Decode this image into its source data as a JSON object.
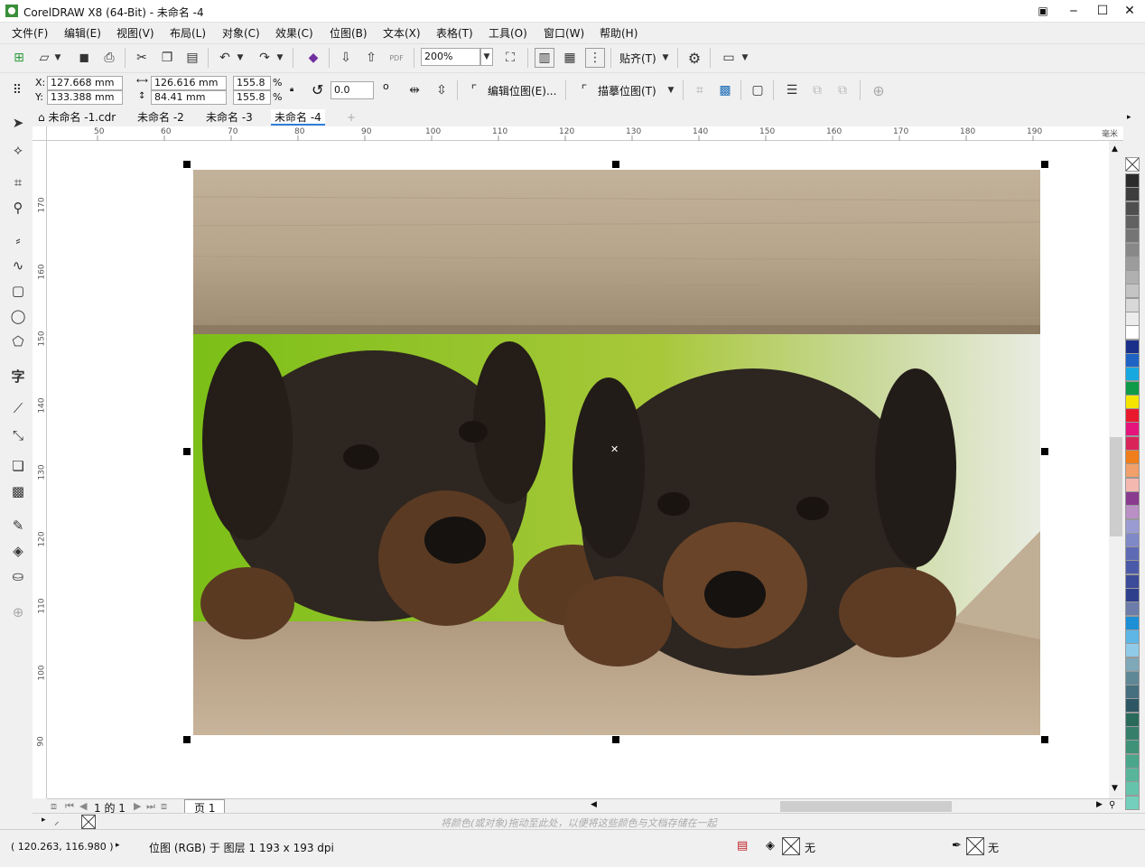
{
  "window": {
    "title": "CorelDRAW X8 (64-Bit) - 未命名 -4",
    "min": "‒",
    "max": "☐",
    "close": "✕"
  },
  "menu": [
    "文件(F)",
    "编辑(E)",
    "视图(V)",
    "布局(L)",
    "对象(C)",
    "效果(C)",
    "位图(B)",
    "文本(X)",
    "表格(T)",
    "工具(O)",
    "窗口(W)",
    "帮助(H)"
  ],
  "standard_toolbar": {
    "zoom_value": "200%",
    "snap_label": "贴齐(T)",
    "pdf_label": "PDF"
  },
  "property_bar": {
    "x_label": "X:",
    "y_label": "Y:",
    "x_value": "127.668 mm",
    "y_value": "133.388 mm",
    "w_value": "126.616 mm",
    "h_value": "84.41 mm",
    "scale_x": "155.8",
    "scale_y": "155.8",
    "pct": "%",
    "rotation": "0.0",
    "degree": "o",
    "edit_bitmap": "编辑位图(E)...",
    "trace_bitmap": "描摹位图(T)"
  },
  "doc_tabs": [
    "未命名 -1.cdr",
    "未命名 -2",
    "未命名 -3",
    "未命名 -4"
  ],
  "active_tab": 3,
  "ruler_h": [
    "50",
    "60",
    "70",
    "80",
    "90",
    "100",
    "110",
    "120",
    "130",
    "140",
    "150",
    "160",
    "170",
    "180",
    "190"
  ],
  "ruler_unit": "毫米",
  "ruler_v": [
    "170",
    "160",
    "150",
    "140",
    "130",
    "120",
    "110",
    "100",
    "90"
  ],
  "pagebar": {
    "page_of": "1 的 1",
    "page_tab": "页 1"
  },
  "hint": "将颜色(或对象)拖动至此处，以便将这些颜色与文档存储在一起",
  "status": {
    "coords": "( 120.263, 116.980 )",
    "object_info": "位图 (RGB) 于 图层 1 193 x 193 dpi",
    "fill": "无",
    "outline": "无"
  },
  "palette_colors": [
    "#2b2b2b",
    "#3d3d3d",
    "#4f4f4f",
    "#626262",
    "#757575",
    "#888888",
    "#9c9c9c",
    "#b0b0b0",
    "#c4c4c4",
    "#d8d8d8",
    "#ececec",
    "#ffffff",
    "#1a2f8a",
    "#1e63c4",
    "#18a8e0",
    "#0e9a48",
    "#f4e400",
    "#e8192c",
    "#e4147c",
    "#d9245a",
    "#f07e1b",
    "#f2a06b",
    "#f4b8b0",
    "#8a3a8f",
    "#b98fc6",
    "#9b9bd4",
    "#7f89c7",
    "#5e6ab4",
    "#4b5aa8",
    "#3c4b99",
    "#2f3f8c",
    "#6d7ca8",
    "#1d8fd6",
    "#5eb6e6",
    "#8fcbe8",
    "#7fa8b8",
    "#5f8896",
    "#456f7e",
    "#2c5664",
    "#2a6a5a",
    "#357e6a",
    "#3f9278",
    "#4aa68a",
    "#58b59a",
    "#66c3ab",
    "#74d0bc"
  ]
}
